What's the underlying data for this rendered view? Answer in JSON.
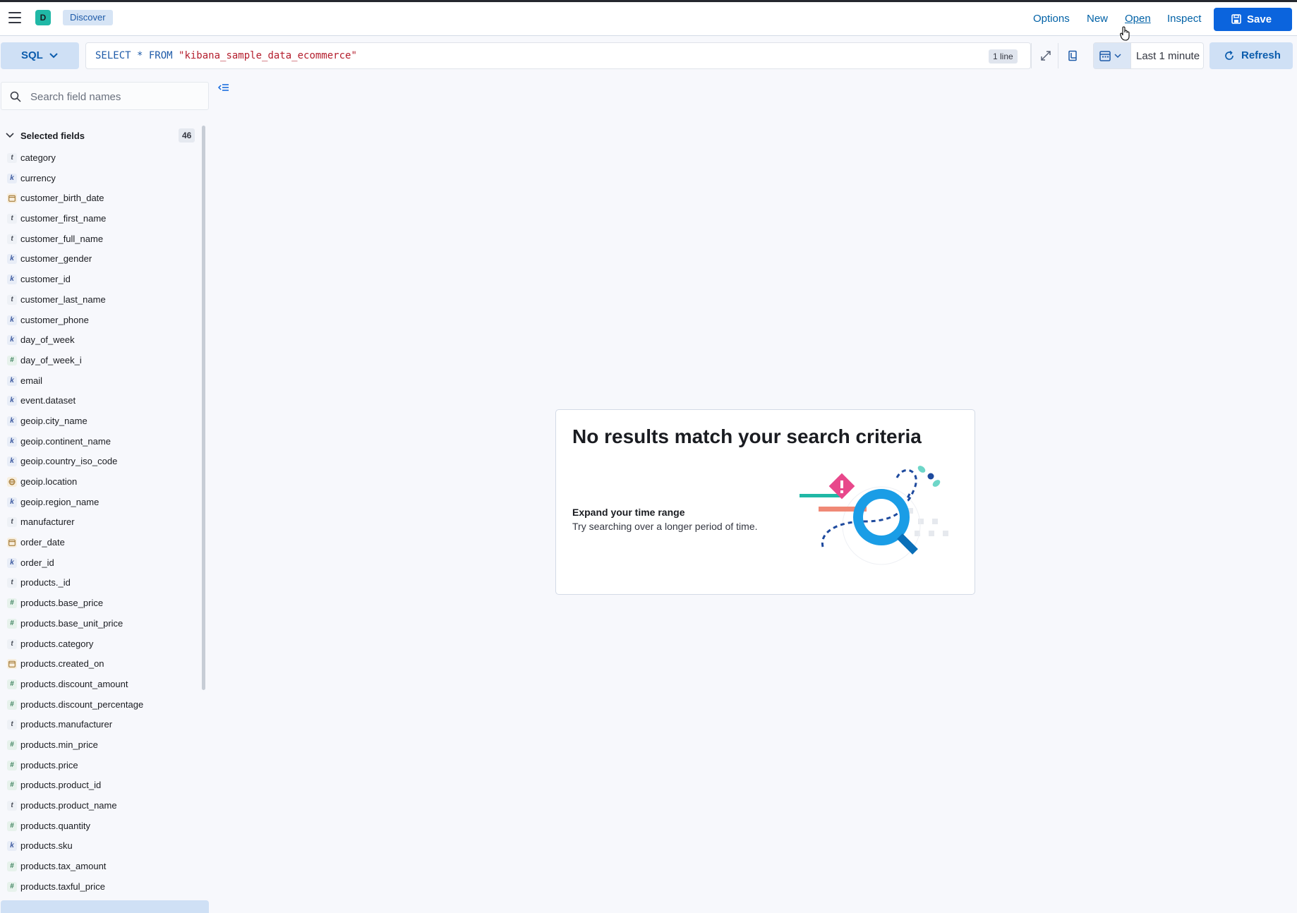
{
  "header": {
    "space_initial": "D",
    "breadcrumb": "Discover",
    "options": "Options",
    "new": "New",
    "open": "Open",
    "inspect": "Inspect",
    "save": "Save"
  },
  "query_bar": {
    "language": "SQL",
    "query_prefix": "SELECT * FROM ",
    "query_index": "\"kibana_sample_data_ecommerce\"",
    "line_count": "1 line",
    "time_range": "Last 1 minute",
    "refresh": "Refresh"
  },
  "sidebar": {
    "search_placeholder": "Search field names",
    "selected_title": "Selected fields",
    "selected_count": "46",
    "fields": [
      {
        "name": "category",
        "type": "t"
      },
      {
        "name": "currency",
        "type": "k"
      },
      {
        "name": "customer_birth_date",
        "type": "date"
      },
      {
        "name": "customer_first_name",
        "type": "t"
      },
      {
        "name": "customer_full_name",
        "type": "t"
      },
      {
        "name": "customer_gender",
        "type": "k"
      },
      {
        "name": "customer_id",
        "type": "k"
      },
      {
        "name": "customer_last_name",
        "type": "t"
      },
      {
        "name": "customer_phone",
        "type": "k"
      },
      {
        "name": "day_of_week",
        "type": "k"
      },
      {
        "name": "day_of_week_i",
        "type": "#"
      },
      {
        "name": "email",
        "type": "k"
      },
      {
        "name": "event.dataset",
        "type": "k"
      },
      {
        "name": "geoip.city_name",
        "type": "k"
      },
      {
        "name": "geoip.continent_name",
        "type": "k"
      },
      {
        "name": "geoip.country_iso_code",
        "type": "k"
      },
      {
        "name": "geoip.location",
        "type": "geo"
      },
      {
        "name": "geoip.region_name",
        "type": "k"
      },
      {
        "name": "manufacturer",
        "type": "t"
      },
      {
        "name": "order_date",
        "type": "date"
      },
      {
        "name": "order_id",
        "type": "k"
      },
      {
        "name": "products._id",
        "type": "t"
      },
      {
        "name": "products.base_price",
        "type": "#"
      },
      {
        "name": "products.base_unit_price",
        "type": "#"
      },
      {
        "name": "products.category",
        "type": "t"
      },
      {
        "name": "products.created_on",
        "type": "date"
      },
      {
        "name": "products.discount_amount",
        "type": "#"
      },
      {
        "name": "products.discount_percentage",
        "type": "#"
      },
      {
        "name": "products.manufacturer",
        "type": "t"
      },
      {
        "name": "products.min_price",
        "type": "#"
      },
      {
        "name": "products.price",
        "type": "#"
      },
      {
        "name": "products.product_id",
        "type": "#"
      },
      {
        "name": "products.product_name",
        "type": "t"
      },
      {
        "name": "products.quantity",
        "type": "#"
      },
      {
        "name": "products.sku",
        "type": "k"
      },
      {
        "name": "products.tax_amount",
        "type": "#"
      },
      {
        "name": "products.taxful_price",
        "type": "#"
      }
    ]
  },
  "empty_state": {
    "title": "No results match your search criteria",
    "subtitle": "Expand your time range",
    "description": "Try searching over a longer period of time."
  },
  "colors": {
    "primary": "#0b64dd",
    "link": "#0061a6",
    "space_avatar": "#20b8a6"
  }
}
